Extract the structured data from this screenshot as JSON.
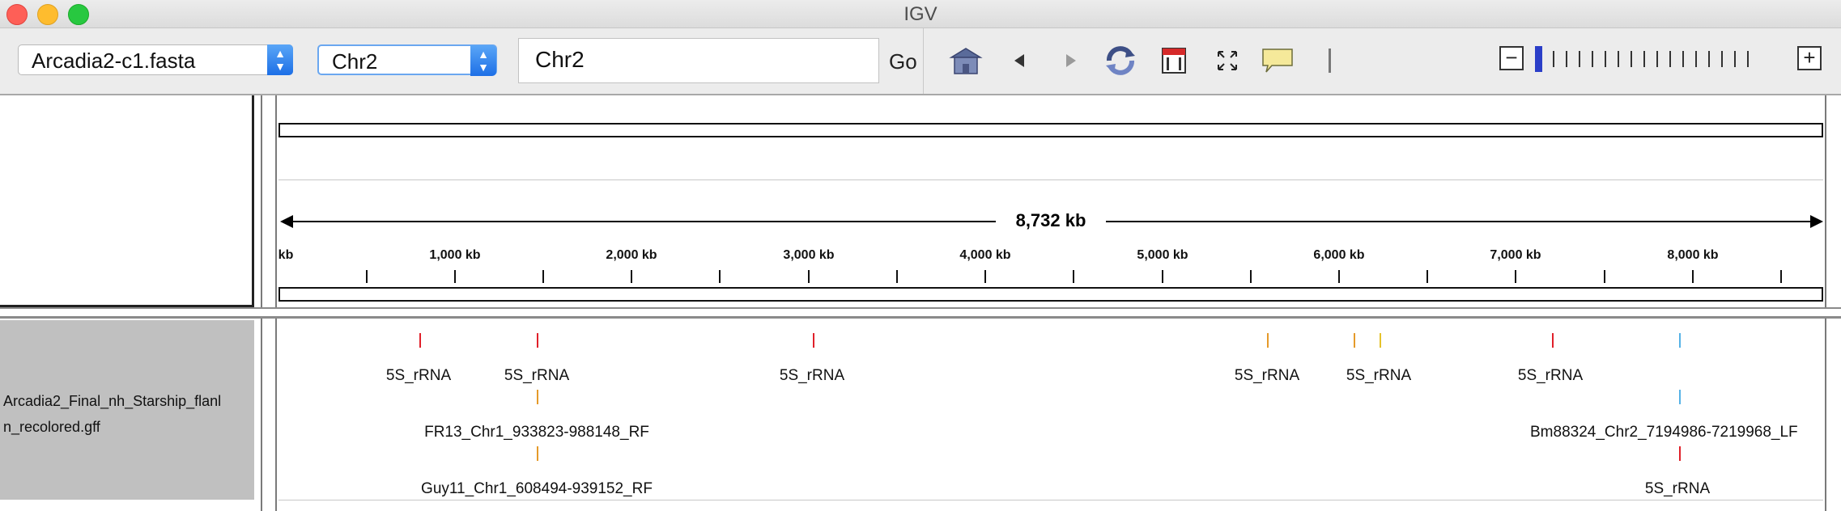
{
  "window": {
    "title": "IGV"
  },
  "toolbar": {
    "genome": "Arcadia2-c1.fasta",
    "chromosome": "Chr2",
    "locus": "Chr2",
    "go_label": "Go",
    "zoom_minus": "−",
    "zoom_plus": "+"
  },
  "ruler": {
    "span_label": "8,732 kb",
    "tick_labels": [
      "kb",
      "1,000 kb",
      "2,000 kb",
      "3,000 kb",
      "4,000 kb",
      "5,000 kb",
      "6,000 kb",
      "7,000 kb",
      "8,000 kb"
    ]
  },
  "track": {
    "name_line1": "Arcadia2_Final_nh_Starship_flanl",
    "name_line2": "n_recolored.gff",
    "labels": [
      "5S_rRNA",
      "5S_rRNA",
      "5S_rRNA",
      "5S_rRNA",
      "5S_rRNA",
      "5S_rRNA",
      "FR13_Chr1_933823-988148_RF",
      "Bm88324_Chr2_7194986-7219968_LF",
      "Guy11_Chr1_608494-939152_RF",
      "5S_rRNA"
    ]
  },
  "colors": {
    "feature_red": "#e0202a",
    "feature_orange": "#e59a2a",
    "feature_blue": "#56b2e6",
    "zoom_thumb": "#2a3ec8"
  }
}
